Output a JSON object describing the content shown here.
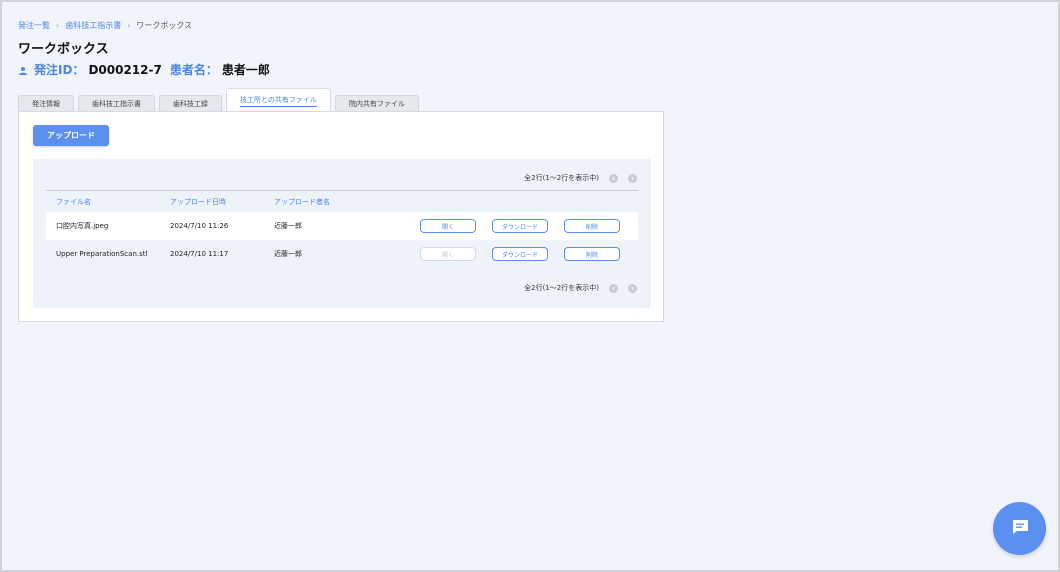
{
  "breadcrumb": {
    "items": [
      "発注一覧",
      "歯科技工指示書",
      "ワークボックス"
    ]
  },
  "page": {
    "title": "ワークボックス"
  },
  "order": {
    "id_label": "発注ID：",
    "id_value": "D000212-7",
    "patient_label": "患者名：",
    "patient_value": "患者一郎"
  },
  "tabs": [
    {
      "label": "発注情報"
    },
    {
      "label": "歯科技工指示書"
    },
    {
      "label": "歯科技工録"
    },
    {
      "label": "技工所との共有ファイル"
    },
    {
      "label": "院内共有ファイル"
    }
  ],
  "active_tab": "技工所との共有ファイル",
  "upload_button": "アップロード",
  "pager": {
    "top": "全2行(1〜2行を表示中)",
    "bottom": "全2行(1〜2行を表示中)"
  },
  "table": {
    "headers": [
      "ファイル名",
      "アップロード日時",
      "アップロード者名"
    ],
    "rows": [
      {
        "name": "口腔内写真.jpeg",
        "date": "2024/7/10 11:26",
        "user": "近藤一郎",
        "open": "開く",
        "download": "ダウンロード",
        "delete": "削除",
        "open_enabled": true
      },
      {
        "name": "Upper PreparationScan.stl",
        "date": "2024/7/10 11:17",
        "user": "近藤一郎",
        "open": "開く",
        "download": "ダウンロード",
        "delete": "削除",
        "open_enabled": false
      }
    ]
  },
  "colors": {
    "accent": "#4a86e8",
    "button": "#5b8ff0",
    "background": "#f1f5fb"
  },
  "icons": {
    "person": "person-icon",
    "chat": "chat-icon",
    "prev": "chevron-left-icon",
    "next": "chevron-right-icon"
  }
}
